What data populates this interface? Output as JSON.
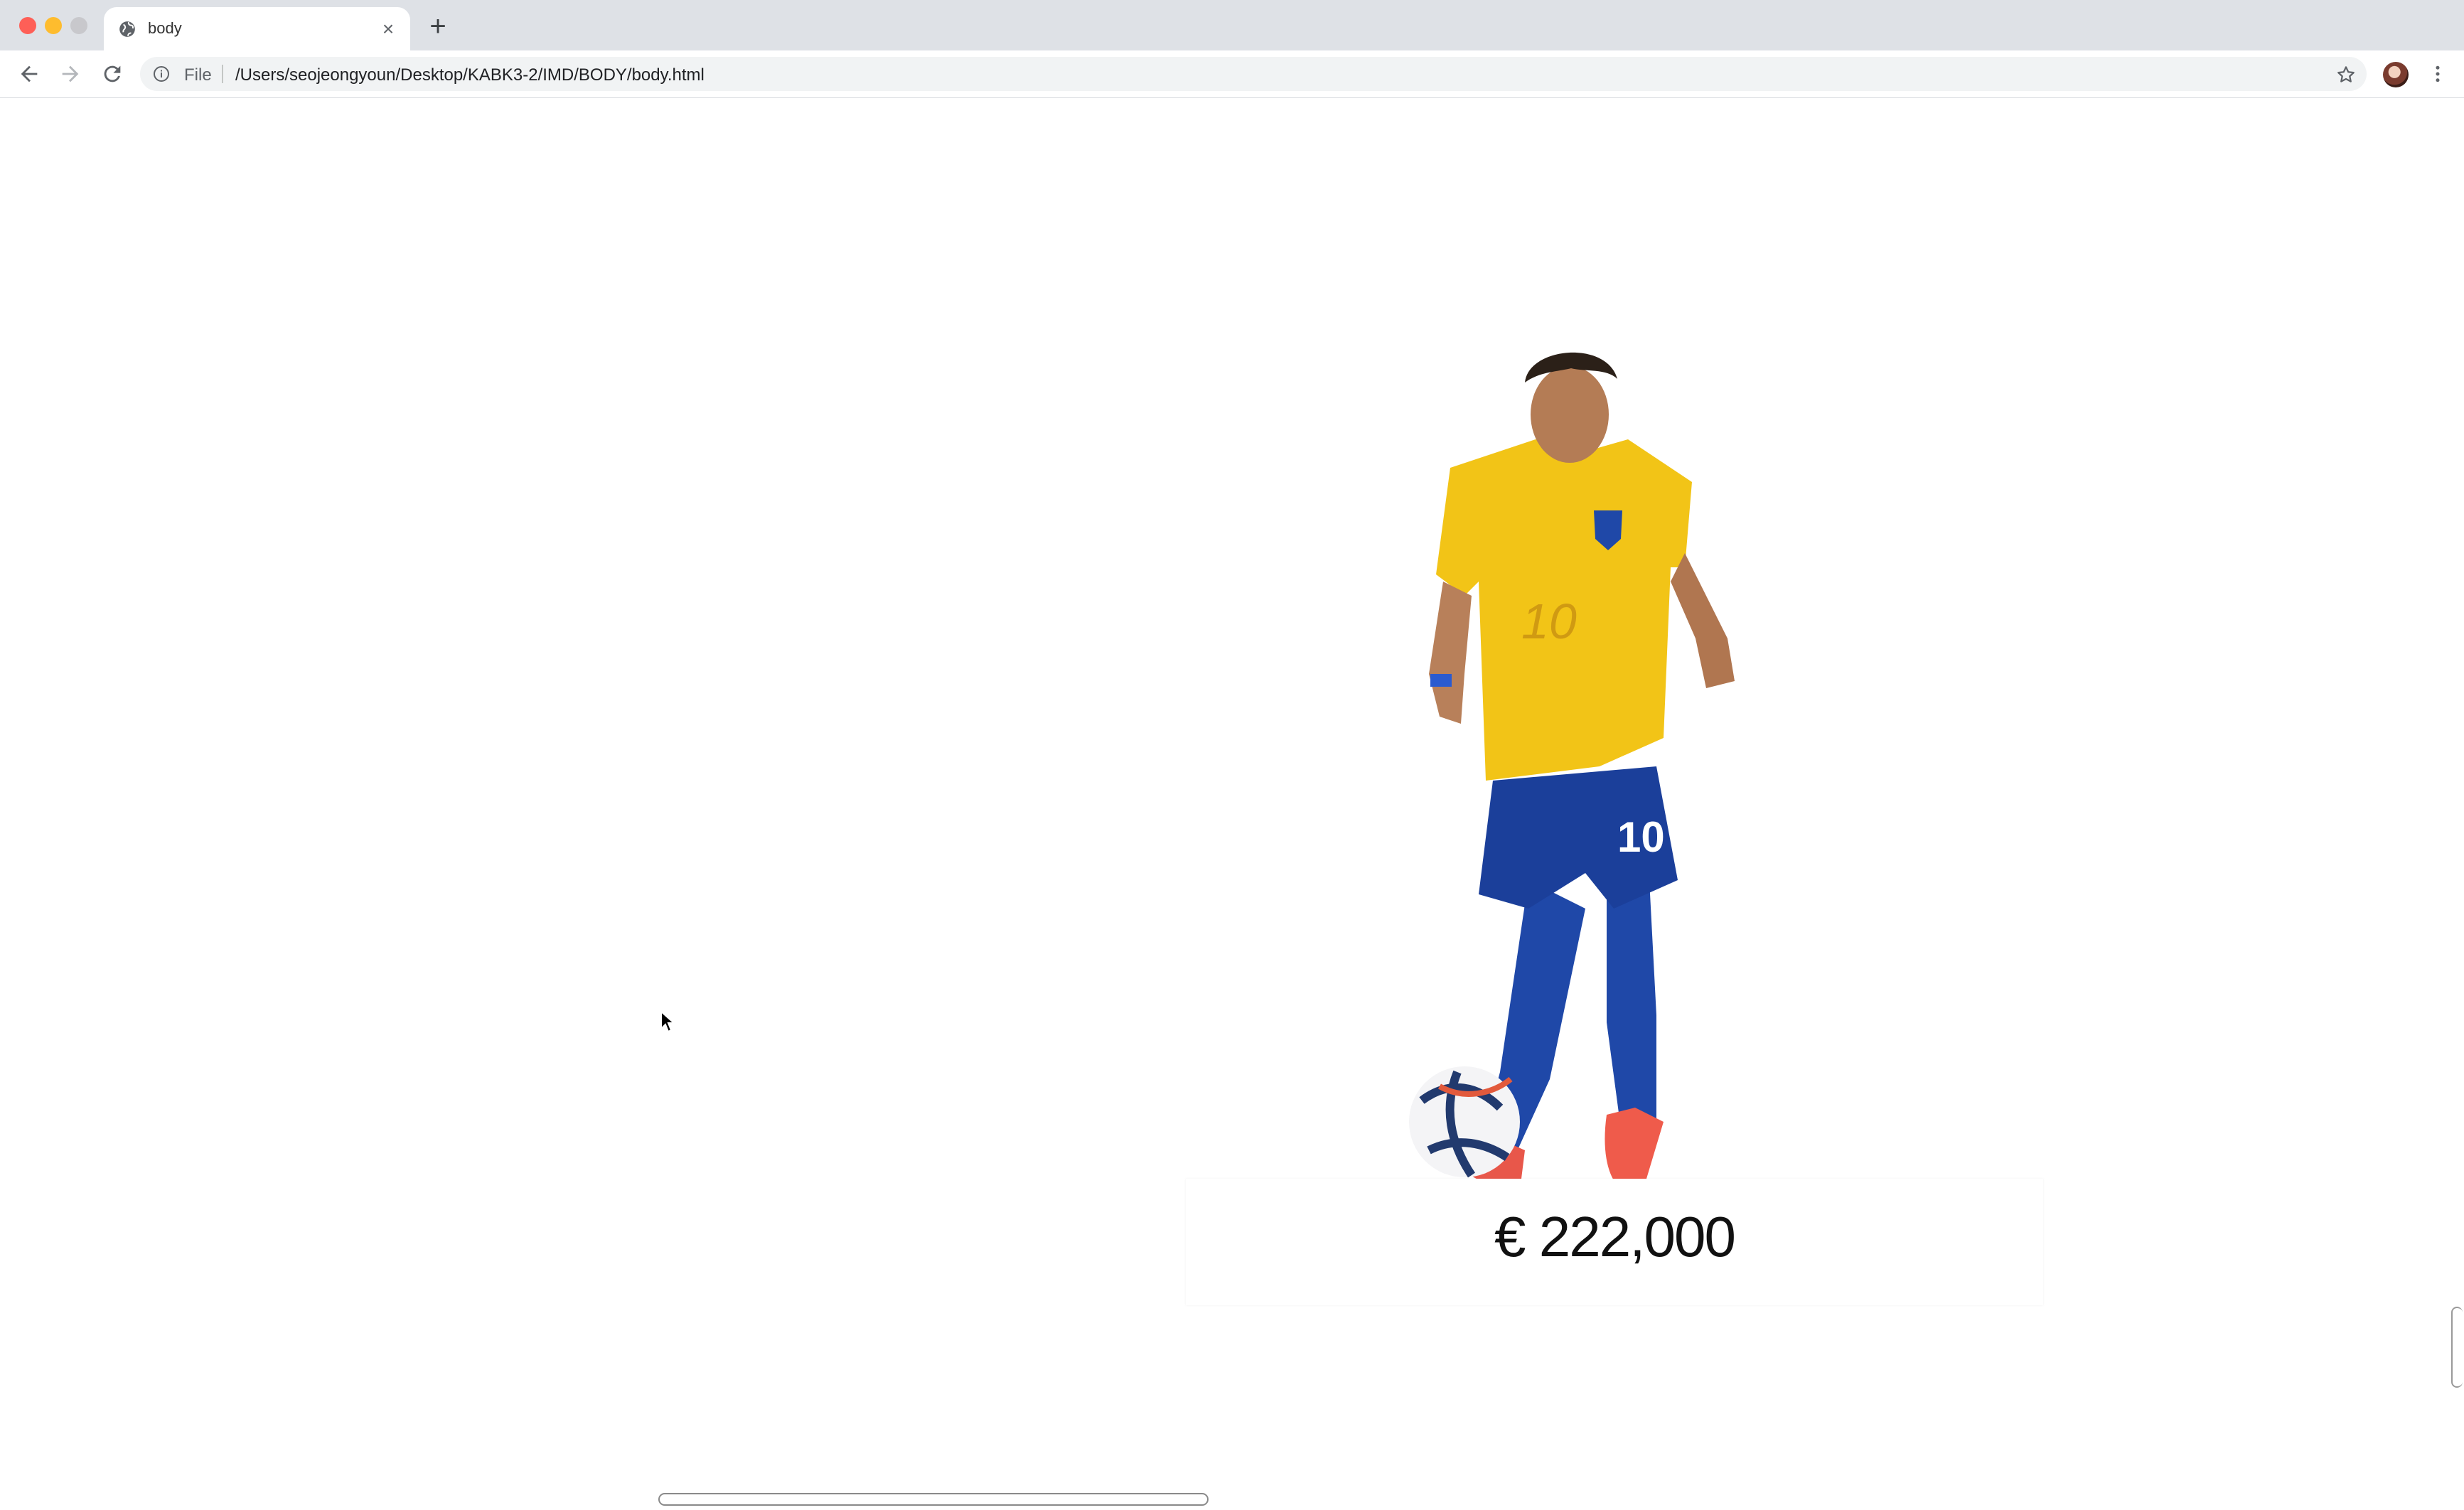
{
  "window": {
    "controls": [
      "close",
      "minimize",
      "zoom"
    ]
  },
  "tabs": [
    {
      "title": "body",
      "icon": "globe-icon",
      "close_icon": "close-icon"
    }
  ],
  "new_tab_icon": "plus-icon",
  "toolbar": {
    "back_icon": "arrow-left-icon",
    "forward_icon": "arrow-right-icon",
    "reload_icon": "reload-icon",
    "scheme_label": "File",
    "url": "/Users/seojeongyoun/Desktop/KABK3-2/IMD/BODY/body.html",
    "bookmark_icon": "star-icon",
    "menu_icon": "kebab-menu-icon"
  },
  "page": {
    "image_subject": "soccer player in yellow Brazil jersey number 10 dribbling a ball",
    "jersey_number": "10",
    "price": "€ 222,000"
  },
  "colors": {
    "tabstrip": "#dee1e6",
    "jersey_yellow": "#f2c417",
    "shorts_blue": "#1f48a8",
    "text": "#111111"
  }
}
